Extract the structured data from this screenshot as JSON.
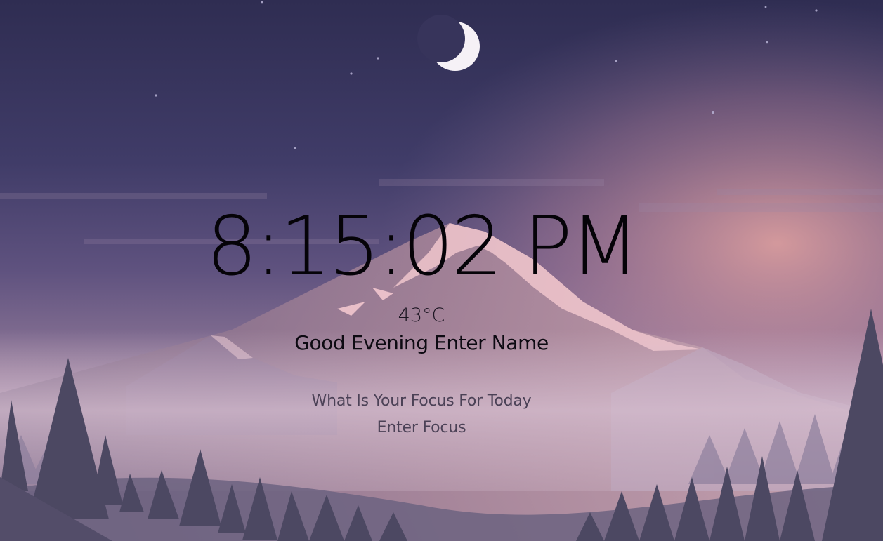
{
  "clock": {
    "time": "8:15:02 PM"
  },
  "weather": {
    "temperature": "43°C"
  },
  "greeting": {
    "salutation": "Good Evening",
    "name": "Enter Name"
  },
  "focus": {
    "question": "What Is Your Focus For Today",
    "value": "Enter Focus"
  },
  "background": {
    "sky_top": "#34325a",
    "sky_mid": "#5a4c7e",
    "horizon_pink": "#c995a6",
    "moon": "#f6f1f6",
    "mountain_snow": "#f3c9cf",
    "trees_dark": "#4c4862"
  }
}
